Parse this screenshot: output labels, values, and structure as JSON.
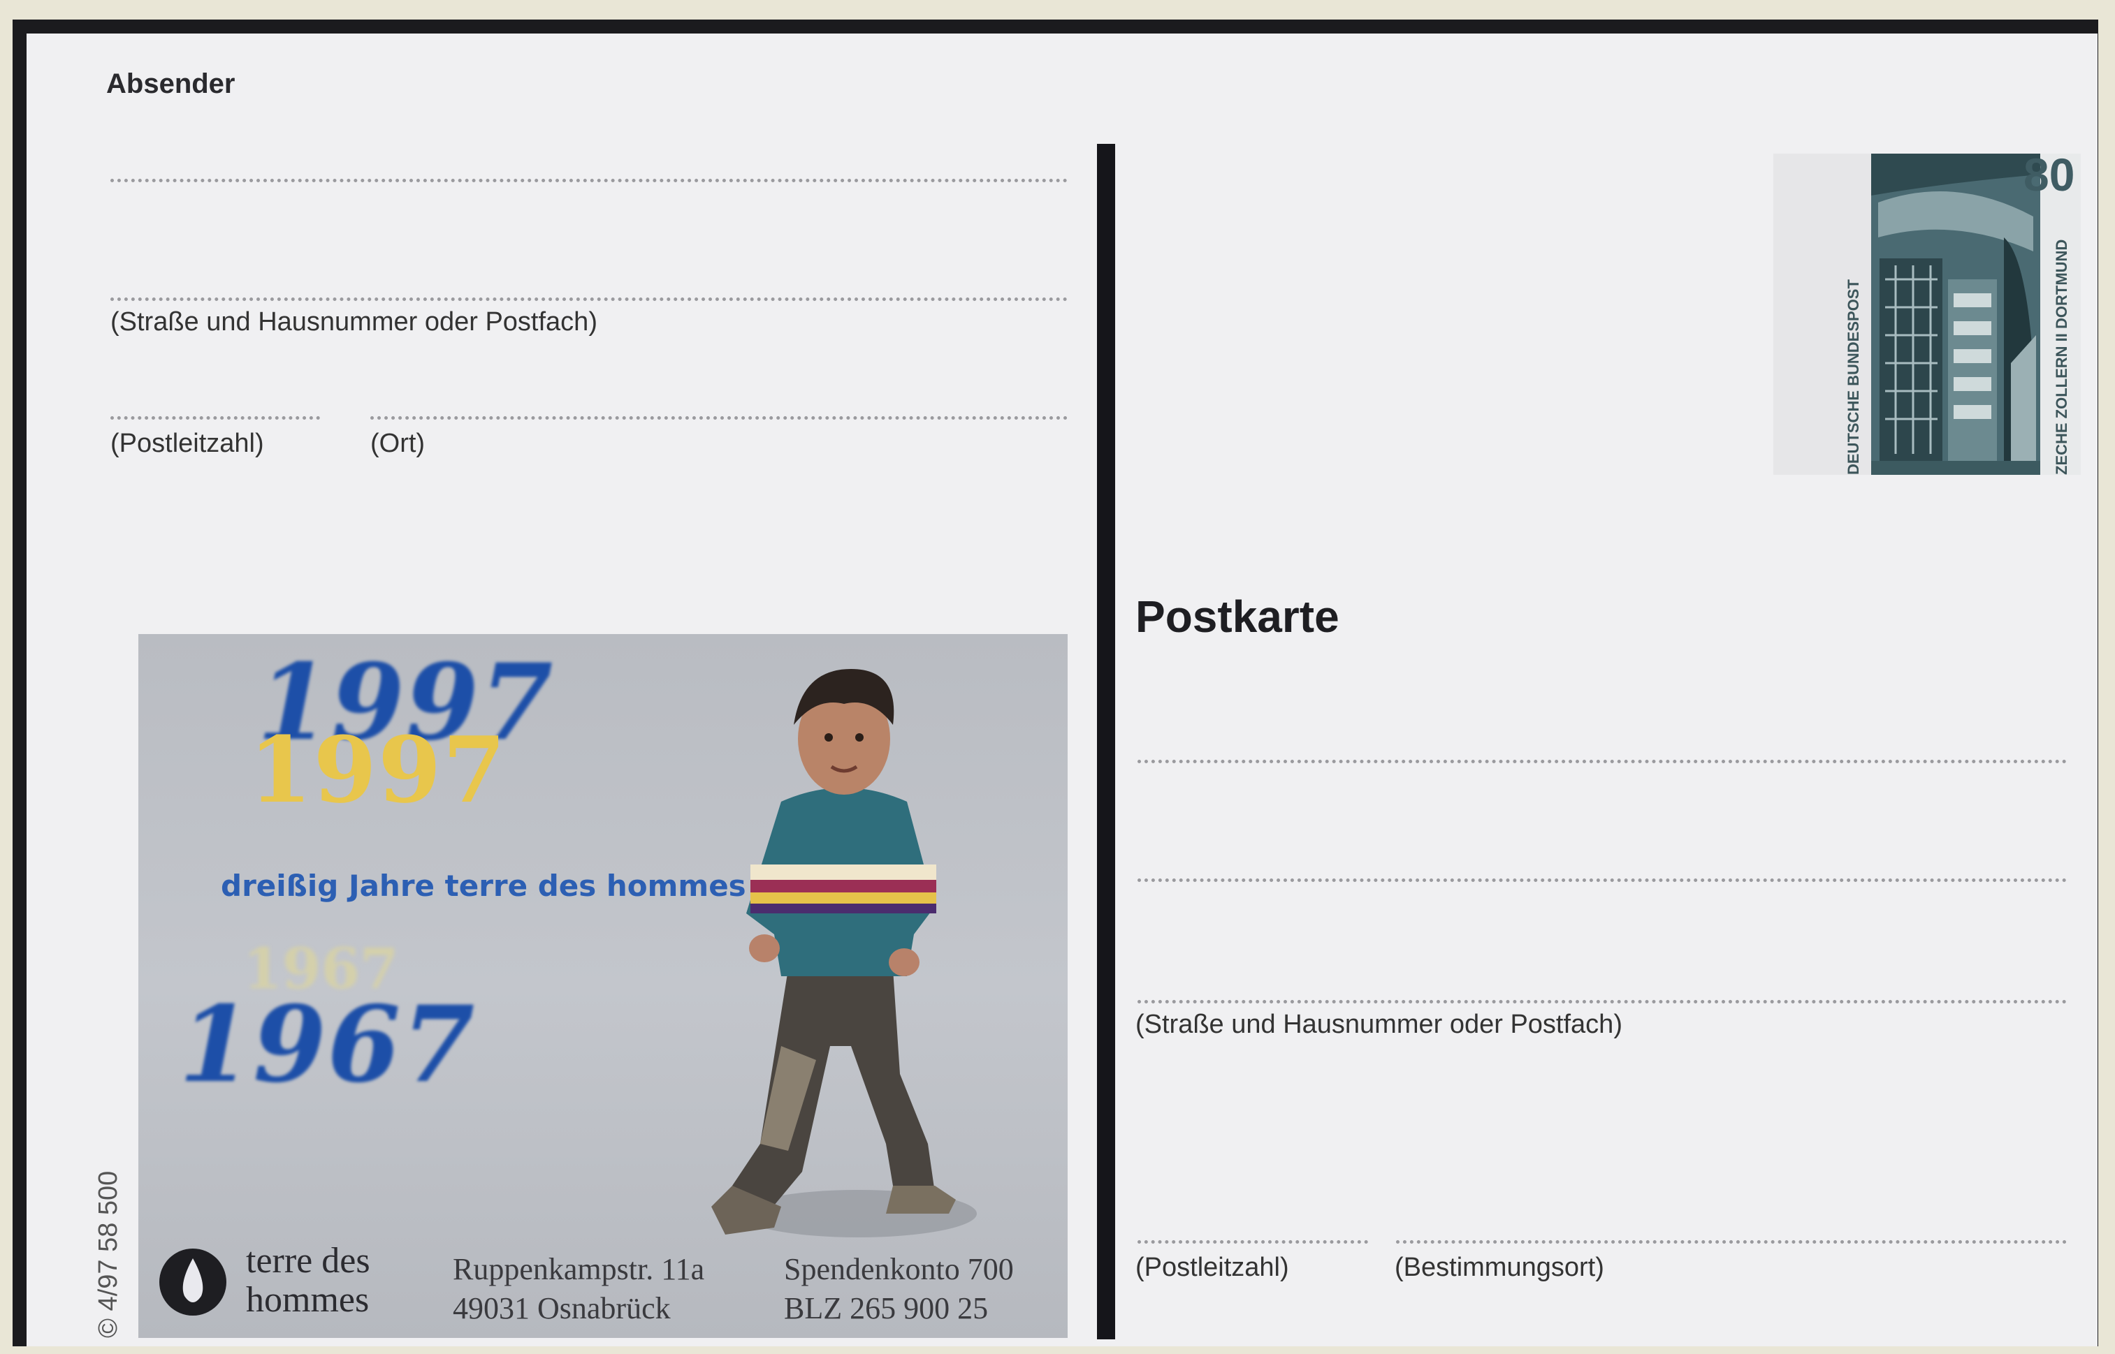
{
  "sender": {
    "title": "Absender",
    "street_label": "(Straße und Hausnummer oder Postfach)",
    "postcode_label": "(Postleitzahl)",
    "city_label": "(Ort)"
  },
  "ad": {
    "year_top": "1997",
    "year_gold": "1997",
    "year_bottom": "1967",
    "year_pale": "1967",
    "tagline": "dreißig Jahre terre des hommes",
    "org_name_line1": "terre des",
    "org_name_line2": "hommes",
    "address_line1": "Ruppenkampstr. 11a",
    "address_line2": "49031 Osnabrück",
    "account_line1": "Spendenkonto 700",
    "account_line2": "BLZ 265 900 25"
  },
  "print_code": "© 4/97  58 500",
  "recipient": {
    "title": "Postkarte",
    "street_label": "(Straße und Hausnummer oder Postfach)",
    "postcode_label": "(Postleitzahl)",
    "destination_label": "(Bestimmungsort)"
  },
  "stamp": {
    "value": "80",
    "issuer": "DEUTSCHE BUNDESPOST",
    "caption": "ZECHE ZOLLERN II DORTMUND",
    "color": "#3f5c63"
  }
}
